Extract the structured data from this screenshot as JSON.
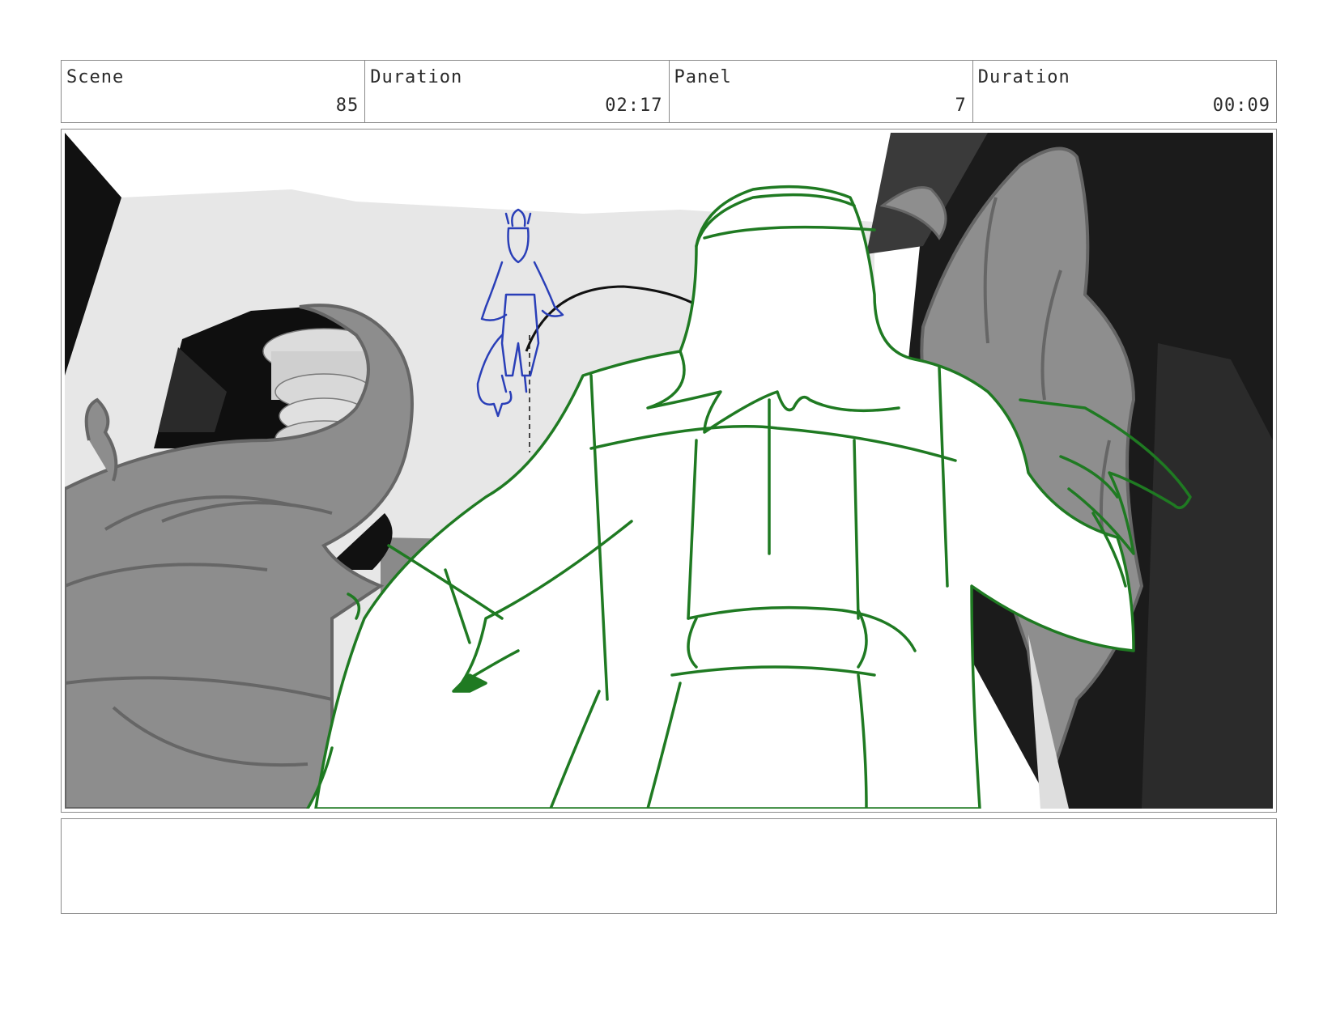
{
  "header": {
    "scene_label": "Scene",
    "scene_value": "85",
    "scene_duration_label": "Duration",
    "scene_duration_value": "02:17",
    "panel_label": "Panel",
    "panel_value": "7",
    "panel_duration_label": "Duration",
    "panel_duration_value": "00:09"
  },
  "notes": {
    "text": ""
  },
  "colors": {
    "green_sketch": "#1f7a22",
    "blue_sketch": "#2a3fb8",
    "grey_leaf": "#8e8e8e",
    "grey_leaf_line": "#666666",
    "dark_wall": "#1b1b1b",
    "light_wall": "#e6e6e6"
  }
}
